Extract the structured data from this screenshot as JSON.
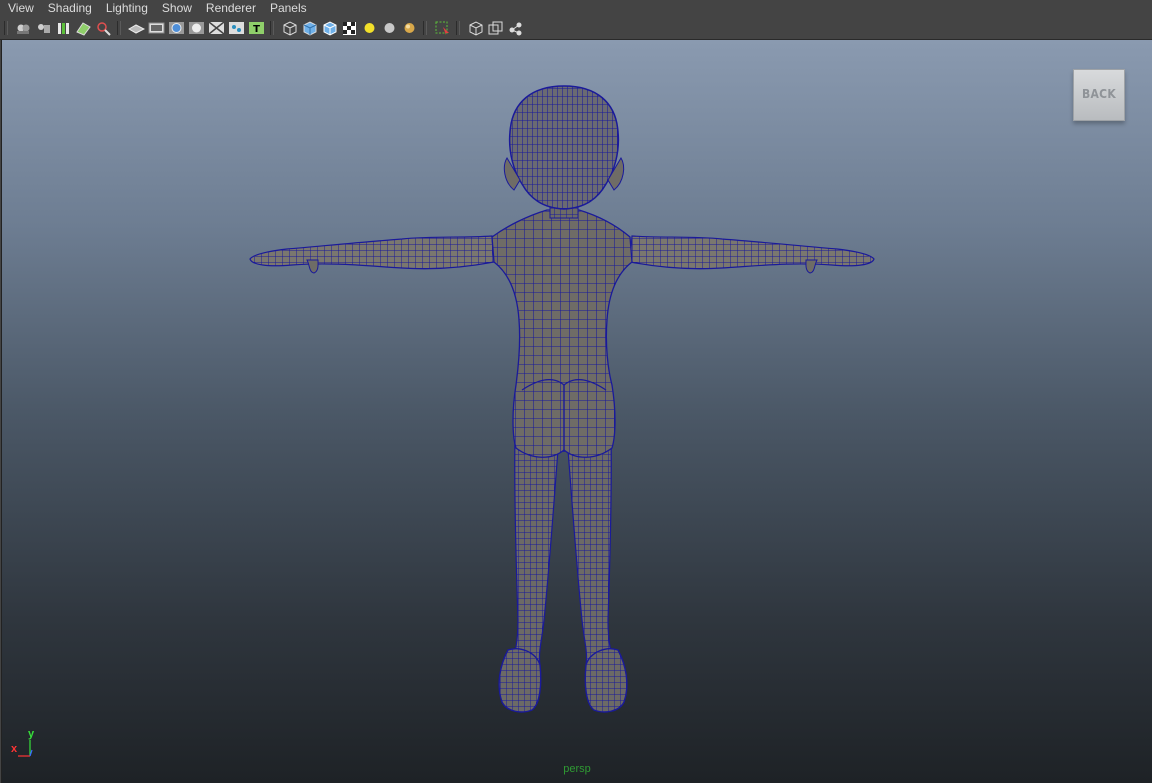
{
  "menu": [
    "View",
    "Shading",
    "Lighting",
    "Show",
    "Renderer",
    "Panels"
  ],
  "toolbar": {
    "groups": [
      [
        "camera-select-icon",
        "camera-attributes-icon",
        "bookmarks-icon",
        "image-plane-icon",
        "two-d-pan-zoom-icon"
      ],
      [
        "grid-icon",
        "film-gate-icon",
        "resolution-gate-icon",
        "gate-mask-icon",
        "field-chart-icon",
        "safe-action-icon",
        "safe-title-icon"
      ],
      [
        "wireframe-icon",
        "smooth-shade-icon",
        "wireframe-on-shaded-icon",
        "textured-icon",
        "default-light-icon",
        "all-lights-icon",
        "shadows-icon"
      ],
      [
        "isolate-select-icon"
      ],
      [
        "xray-icon",
        "xray-joints-icon",
        "xray-components-icon"
      ]
    ]
  },
  "viewport": {
    "viewcube_label": "BACK",
    "camera_name": "persp",
    "axis_x": "x",
    "axis_y": "y",
    "background_top": "#8a9ab0",
    "background_bottom": "#1e2226",
    "wire_color": "#1a1a9a"
  }
}
